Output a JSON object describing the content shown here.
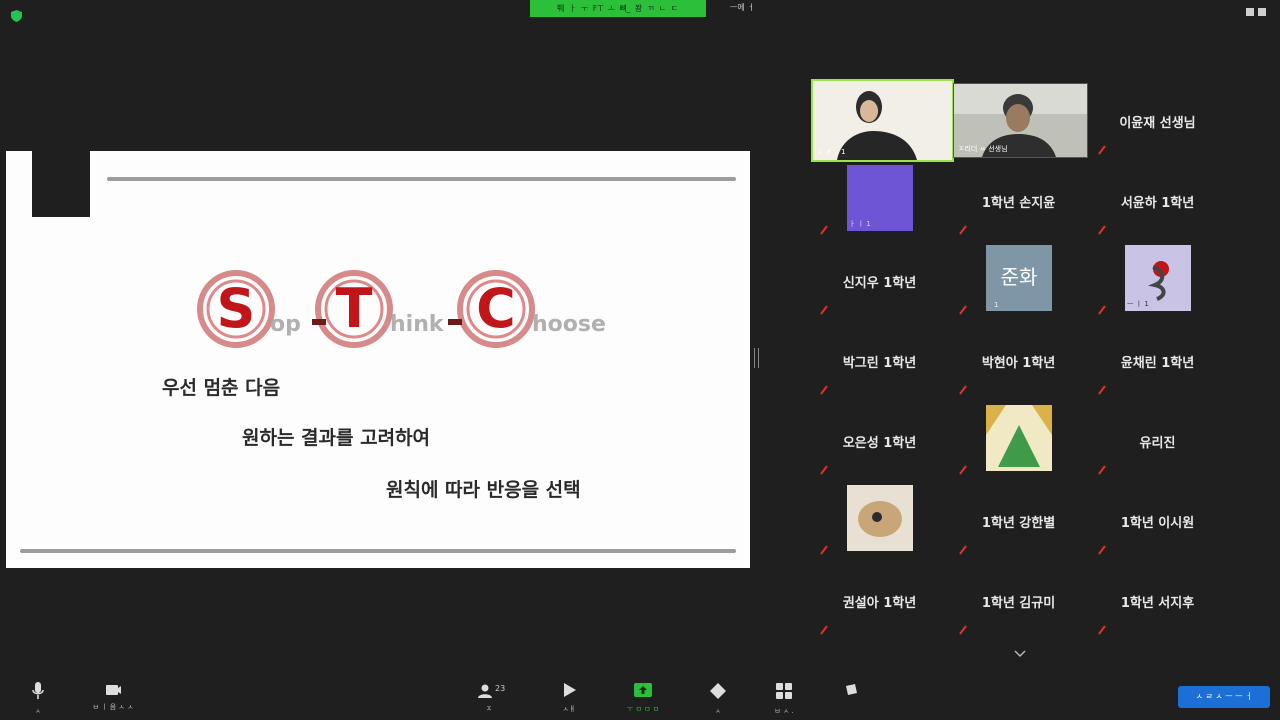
{
  "topbar": {
    "share_banner": "쀄 ㅏ ㅜ   FT   ㅗ 뼈 ̲ 봥 ㄲ     ㄴ ㄷ",
    "view_label": "ㅡ에 ㅓ"
  },
  "slide": {
    "logo_text": "Stop-Think-Choose",
    "line1": "우선 멈춘 다음",
    "line2": "원하는 결과를 고려하여",
    "line3": "원칙에 따라 반응을 선택"
  },
  "gallery": {
    "video1_caption": "ㅅ ㅎ ..   1",
    "video2_caption": "ㅈ리더 ㅆ 선생님",
    "tiles": [
      {
        "name": "이윤재 선생님"
      },
      {
        "name": "1학년 손지윤"
      },
      {
        "name": "서윤하 1학년"
      },
      {
        "name": "신지우 1학년"
      },
      {
        "name": "준화",
        "caption": "1"
      },
      {
        "name": "박그린 1학년"
      },
      {
        "name": "박현아 1학년"
      },
      {
        "name": "윤채린 1학년"
      },
      {
        "name": "오은성 1학년"
      },
      {
        "name": "유리진"
      },
      {
        "name": "1학년 강한별"
      },
      {
        "name": "1학년 이시원"
      },
      {
        "name": "권설아 1학년"
      },
      {
        "name": "1학년 김규미"
      },
      {
        "name": "1학년 서지후"
      }
    ],
    "tile_caption_purple": "ㅏ    ㅣ    1",
    "tile_caption_flower": "ㅡ    ㅣ    1"
  },
  "toolbar": {
    "mute": "ㅅ",
    "video": "ㅂ ㅣ 음 ㅅ ㅅ",
    "participants": "ㅈ",
    "participants_count": "23",
    "chat": "ㅅㅐ",
    "share": "ㅜ ㅁ ㅁ ㅁ",
    "reactions": "ㅅ",
    "apps": "ㅂ ㅅ .",
    "more": ""
  },
  "end_button": "ㅅ ㄹ ㅅ ㅡ ㅡ ㅓ",
  "colors": {
    "background": "#1f1f1f",
    "accent_green": "#2bbf3a",
    "logo_red": "#c0161a",
    "end_blue": "#1d6fd8",
    "muted_red": "#e03131"
  }
}
